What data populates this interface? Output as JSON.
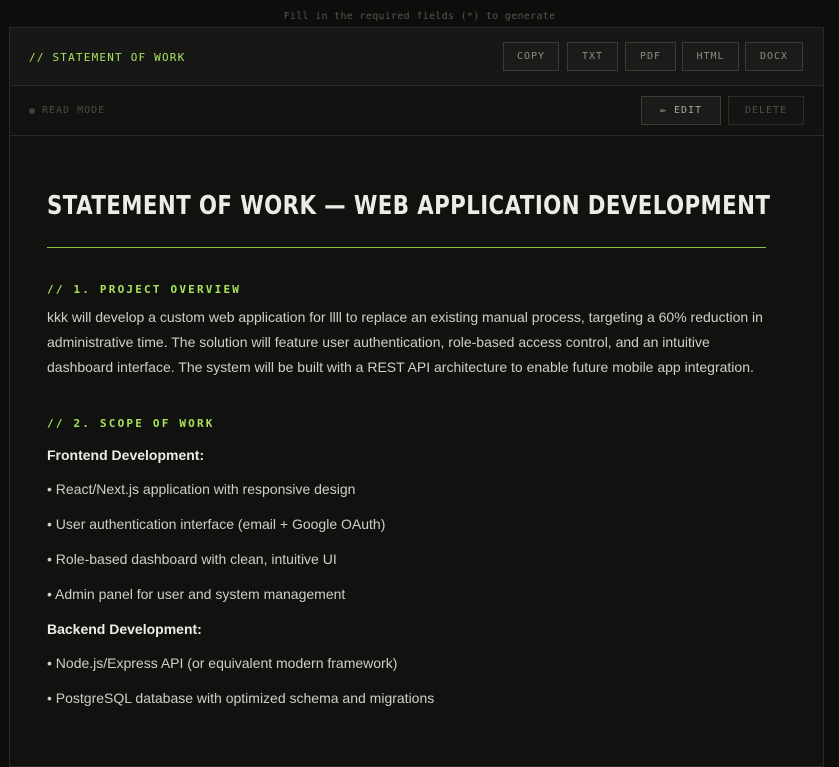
{
  "hint": "Fill in the required fields (*) to generate",
  "header": {
    "title": "// STATEMENT OF WORK",
    "buttons": [
      "COPY",
      "TXT",
      "PDF",
      "HTML",
      "DOCX"
    ]
  },
  "toolbar": {
    "mode": "READ MODE",
    "edit": "✏ EDIT",
    "delete": "DELETE"
  },
  "document": {
    "title": "STATEMENT OF WORK — WEB APPLICATION DEVELOPMENT",
    "sections": [
      {
        "heading": "// 1. PROJECT OVERVIEW",
        "paragraph": "kkk will develop a custom web application for llll to replace an existing manual process, targeting a 60% reduction in administrative time. The solution will feature user authentication, role-based access control, and an intuitive dashboard interface. The system will be built with a REST API architecture to enable future mobile app integration."
      },
      {
        "heading": "// 2. SCOPE OF WORK",
        "groups": [
          {
            "subheading": "Frontend Development:",
            "items": [
              "• React/Next.js application with responsive design",
              "• User authentication interface (email + Google OAuth)",
              "• Role-based dashboard with clean, intuitive UI",
              "• Admin panel for user and system management"
            ]
          },
          {
            "subheading": "Backend Development:",
            "items": [
              "• Node.js/Express API (or equivalent modern framework)",
              "• PostgreSQL database with optimized schema and migrations"
            ]
          }
        ]
      }
    ]
  }
}
